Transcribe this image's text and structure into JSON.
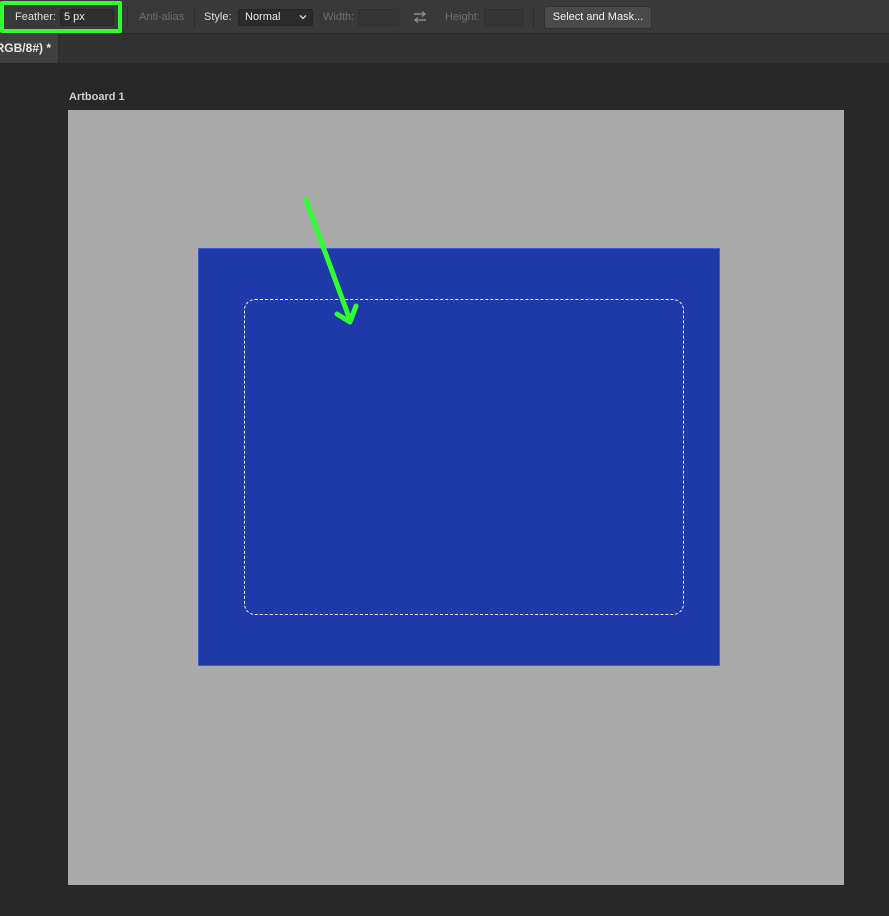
{
  "options_bar": {
    "feather_label": "Feather:",
    "feather_value": "5 px",
    "anti_alias_label": "Anti-alias",
    "style_label": "Style:",
    "style_value": "Normal",
    "width_label": "Width:",
    "width_value": "",
    "height_label": "Height:",
    "height_value": "",
    "select_and_mask_label": "Select and Mask...",
    "swap_icon": "swap-arrows-icon",
    "chevron_icon": "chevron-down-icon"
  },
  "document": {
    "tab_title": "RGB/8#) *"
  },
  "canvas": {
    "artboard_label": "Artboard 1"
  },
  "colors": {
    "highlight": "#2fff2f",
    "shape_fill": "#1f3aa8",
    "artboard_bg": "#aaaaaa",
    "annotation_arrow": "#2fff2f"
  }
}
